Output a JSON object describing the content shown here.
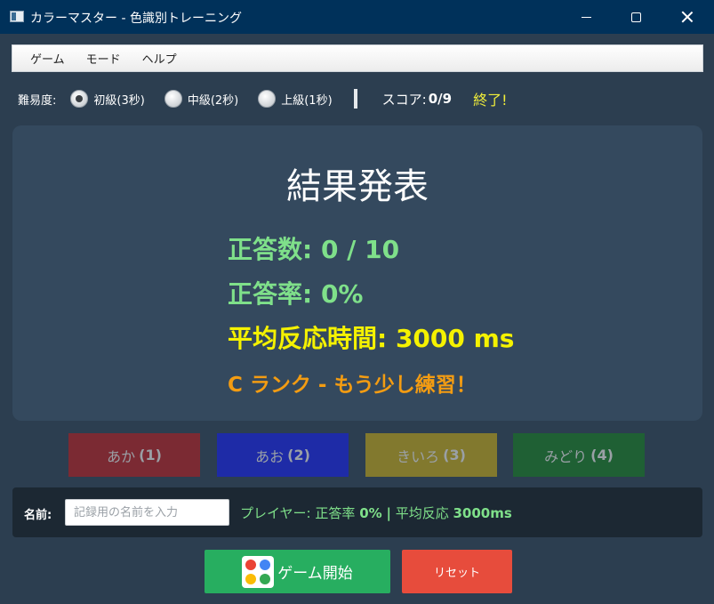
{
  "window": {
    "title": "カラーマスター - 色識別トレーニング"
  },
  "menu": {
    "items": [
      "ゲーム",
      "モード",
      "ヘルプ"
    ]
  },
  "difficulty": {
    "label": "難易度:",
    "options": [
      {
        "label": "初級(3秒)",
        "selected": true
      },
      {
        "label": "中級(2秒)",
        "selected": false
      },
      {
        "label": "上級(1秒)",
        "selected": false
      }
    ]
  },
  "score": {
    "label": "スコア:",
    "value": "0/9",
    "status": "終了!"
  },
  "result": {
    "title": "結果発表",
    "correct_label": "正答数:",
    "correct_value": "0 / 10",
    "rate_label": "正答率:",
    "rate_value": "0%",
    "time_label": "平均反応時間:",
    "time_value": "3000 ms",
    "rank_text": "C ランク - もう少し練習！"
  },
  "color_buttons": [
    {
      "label": "あか",
      "key": "(1)",
      "color": "#7b2a33"
    },
    {
      "label": "あお",
      "key": "(2)",
      "color": "#1e2ba7"
    },
    {
      "label": "きいろ",
      "key": "(3)",
      "color": "#82792e"
    },
    {
      "label": "みどり",
      "key": "(4)",
      "color": "#1f6034"
    }
  ],
  "name_row": {
    "label": "名前:",
    "input_value": "",
    "placeholder": "記録用の名前を入力",
    "player_prefix": "プレイヤー:",
    "player_rate_label": "正答率",
    "player_rate_value": "0%",
    "player_sep": "|",
    "player_time_label": "平均反応",
    "player_time_value": "3000ms"
  },
  "actions": {
    "start_label": "ゲーム開始",
    "reset_label": "リセット"
  },
  "colors": {
    "background": "#2c3e50",
    "panel": "#34495e",
    "titlebar": "#00315a",
    "accent_green": "#7fe08a",
    "accent_yellow": "#f5f200",
    "accent_orange": "#f39c12",
    "start_button": "#27ae60",
    "reset_button": "#e74c3c"
  },
  "icons": {
    "app": "window-app-icon",
    "start": "game-colors-icon"
  }
}
